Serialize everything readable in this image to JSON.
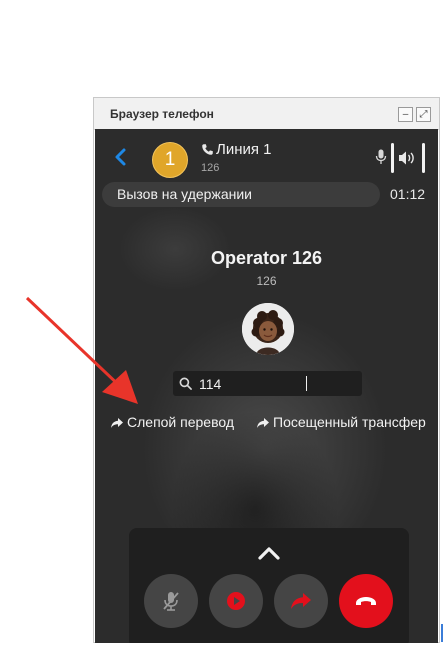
{
  "window": {
    "title": "Браузер телефон",
    "minimize_label": "–",
    "expand_label": "⤢"
  },
  "header": {
    "line_badge": "1",
    "line_name": "Линия 1",
    "line_sub": "126",
    "back_icon": "chevron-left-icon",
    "accent": "#1e88e5"
  },
  "status": {
    "text": "Вызов на удержании",
    "timer": "01:12"
  },
  "operator": {
    "name": "Operator 126",
    "number": "126"
  },
  "search": {
    "value": "114",
    "icon": "search-icon"
  },
  "transfer": {
    "blind": "Слепой перевод",
    "attended": "Посещенный трансфер"
  },
  "controls": {
    "buttons": [
      "mute-mic-icon",
      "record-icon",
      "transfer-icon",
      "hangup-icon"
    ],
    "hangup_color": "#e3101c",
    "record_color": "#e3101c"
  },
  "annotation": {
    "arrow_color": "#e8342a"
  }
}
